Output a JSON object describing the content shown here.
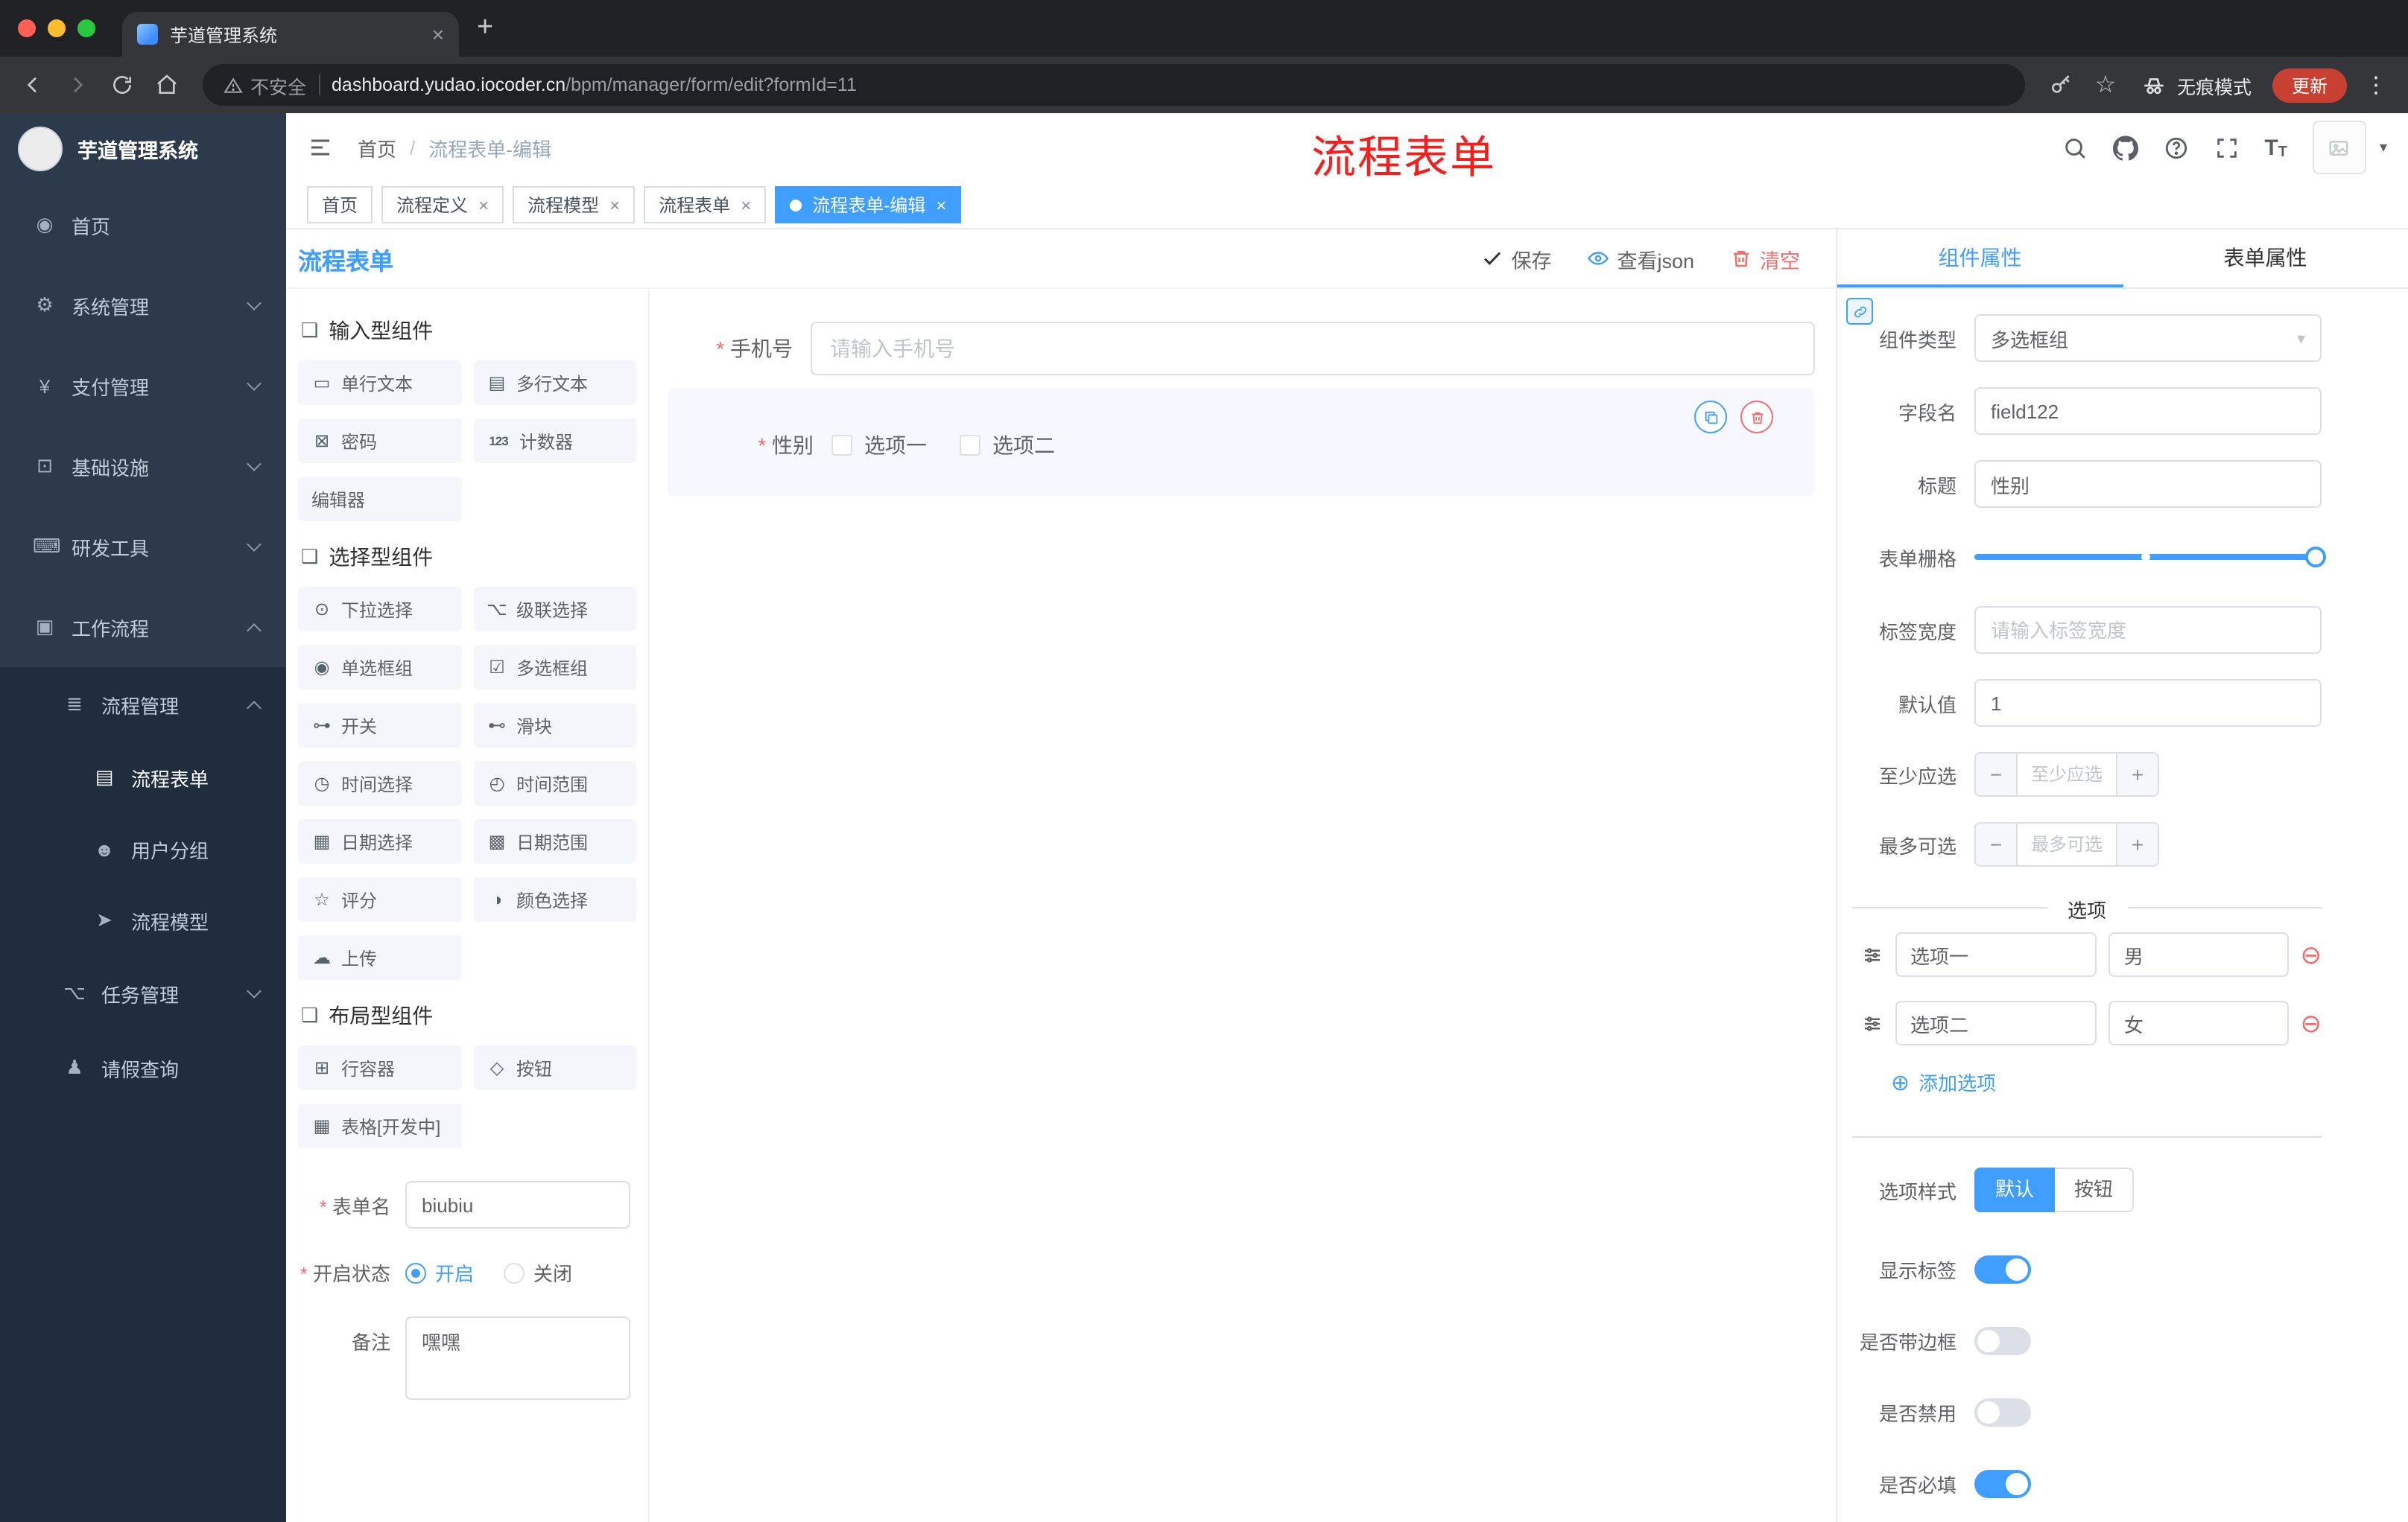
{
  "colors": {
    "primary": "#409eff",
    "danger": "#f56c6c",
    "annotation_red": "#f81d1d",
    "sidebar_bg": "#2d3a4b",
    "submenu_bg": "#1f2d3d",
    "tag_active": "#409eff"
  },
  "glyphs": {
    "close": "×",
    "plus": "+",
    "star": "☆",
    "dots": "⋮",
    "caret": "▾",
    "menu_home": "◉",
    "menu_system": "⚙",
    "menu_pay": "¥",
    "menu_infra": "⊡",
    "menu_dev": "⌨",
    "menu_workflow": "▣",
    "menu_process": "≣",
    "menu_form": "▤",
    "menu_usergroup": "☻",
    "menu_model": "➤",
    "menu_task": "⌥",
    "menu_leave": "♟",
    "group_icon": "❏",
    "p_single": "▭",
    "p_multi": "▤",
    "p_password": "⊠",
    "p_counter": "123",
    "p_select": "⊙",
    "p_cascade": "⌥",
    "p_radio": "◉",
    "p_checkbox": "☑",
    "p_switch": "⊶",
    "p_slider": "⊷",
    "p_time": "◷",
    "p_timerange": "◴",
    "p_date": "▦",
    "p_daterange": "▩",
    "p_rate": "☆",
    "p_color": "◑",
    "p_upload": "☁",
    "p_row": "⊞",
    "p_button": "◇",
    "p_table": "▦",
    "remove_circle": "⊖",
    "add_circle": "⊕"
  },
  "browser": {
    "tab_title": "芋道管理系统",
    "security": "不安全",
    "url_host": "dashboard.yudao.iocoder.cn",
    "url_path": "/bpm/manager/form/edit?formId=11",
    "incognito": "无痕模式",
    "update": "更新"
  },
  "sidebar": {
    "title": "芋道管理系统",
    "items": [
      {
        "label": "首页"
      },
      {
        "label": "系统管理"
      },
      {
        "label": "支付管理"
      },
      {
        "label": "基础设施"
      },
      {
        "label": "研发工具"
      },
      {
        "label": "工作流程"
      },
      {
        "label": "流程管理"
      },
      {
        "label": "流程表单"
      },
      {
        "label": "用户分组"
      },
      {
        "label": "流程模型"
      },
      {
        "label": "任务管理"
      },
      {
        "label": "请假查询"
      }
    ]
  },
  "header": {
    "breadcrumb_home": "首页",
    "breadcrumb_sep": "/",
    "breadcrumb_current": "流程表单-编辑",
    "annotation": "流程表单"
  },
  "tags": [
    {
      "label": "首页"
    },
    {
      "label": "流程定义"
    },
    {
      "label": "流程模型"
    },
    {
      "label": "流程表单"
    },
    {
      "label": "流程表单-编辑"
    }
  ],
  "designer": {
    "title": "流程表单",
    "save": "保存",
    "view_json": "查看json",
    "clear": "清空",
    "group_input": "输入型组件",
    "group_select": "选择型组件",
    "group_layout": "布局型组件",
    "palette_input": [
      "单行文本",
      "多行文本",
      "密码",
      "计数器",
      "编辑器"
    ],
    "palette_select": [
      "下拉选择",
      "级联选择",
      "单选框组",
      "多选框组",
      "开关",
      "滑块",
      "时间选择",
      "时间范围",
      "日期选择",
      "日期范围",
      "评分",
      "颜色选择",
      "上传"
    ],
    "palette_layout": [
      "行容器",
      "按钮",
      "表格[开发中]"
    ],
    "meta": {
      "name_label": "表单名",
      "name_value": "biubiu",
      "status_label": "开启状态",
      "status_on": "开启",
      "status_off": "关闭",
      "remark_label": "备注",
      "remark_value": "嘿嘿"
    },
    "canvas": {
      "phone_label": "手机号",
      "phone_placeholder": "请输入手机号",
      "gender_label": "性别",
      "gender_options": [
        "选项一",
        "选项二"
      ]
    }
  },
  "props": {
    "tab_component": "组件属性",
    "tab_form": "表单属性",
    "type_label": "组件类型",
    "type_value": "多选框组",
    "field_label": "字段名",
    "field_value": "field122",
    "title_label": "标题",
    "title_value": "性别",
    "grid_label": "表单栅格",
    "width_label": "标签宽度",
    "width_placeholder": "请输入标签宽度",
    "default_label": "默认值",
    "default_value": "1",
    "min_label": "至少应选",
    "min_placeholder": "至少应选",
    "max_label": "最多可选",
    "max_placeholder": "最多可选",
    "options_title": "选项",
    "options": [
      {
        "label": "选项一",
        "value": "男"
      },
      {
        "label": "选项二",
        "value": "女"
      }
    ],
    "add_option": "添加选项",
    "style_label": "选项样式",
    "style_default": "默认",
    "style_button": "按钮",
    "toggles": [
      {
        "label": "显示标签",
        "on": true
      },
      {
        "label": "是否带边框",
        "on": false
      },
      {
        "label": "是否禁用",
        "on": false
      },
      {
        "label": "是否必填",
        "on": true
      }
    ]
  }
}
